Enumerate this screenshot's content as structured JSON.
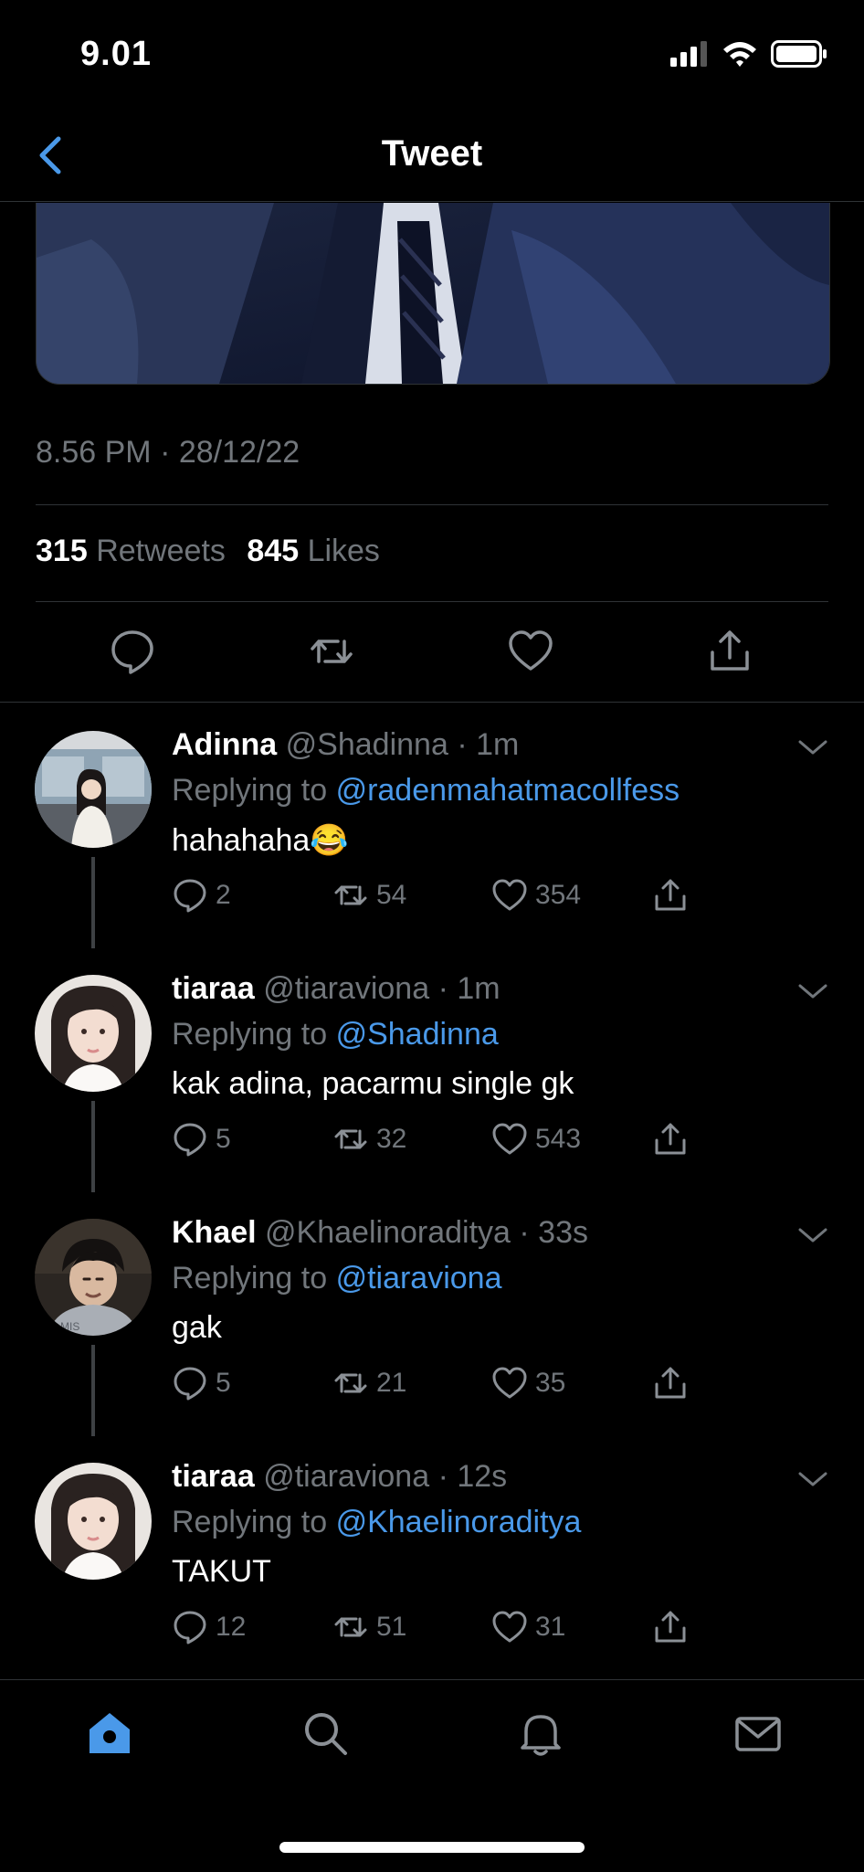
{
  "status": {
    "time": "9.01"
  },
  "nav": {
    "title": "Tweet"
  },
  "tweet": {
    "timestamp": "8.56 PM · 28/12/22",
    "retweets_count": "315",
    "retweets_label": "Retweets",
    "likes_count": "845",
    "likes_label": "Likes"
  },
  "replies": [
    {
      "name": "Adinna",
      "handle": "@Shadinna",
      "time": "· 1m",
      "replying_prefix": "Replying to",
      "replying_to": "@radenmahatmacollfess",
      "text": "hahahaha😂",
      "replies": "2",
      "retweets": "54",
      "likes": "354"
    },
    {
      "name": "tiaraa",
      "handle": "@tiaraviona",
      "time": "· 1m",
      "replying_prefix": "Replying to",
      "replying_to": "@Shadinna",
      "text": "kak adina, pacarmu single gk",
      "replies": "5",
      "retweets": "32",
      "likes": "543"
    },
    {
      "name": "Khael",
      "handle": "@Khaelinoraditya",
      "time": "· 33s",
      "replying_prefix": "Replying to",
      "replying_to": "@tiaraviona",
      "text": "gak",
      "replies": "5",
      "retweets": "21",
      "likes": "35"
    },
    {
      "name": "tiaraa",
      "handle": "@tiaraviona",
      "time": "· 12s",
      "replying_prefix": "Replying to",
      "replying_to": "@Khaelinoraditya",
      "text": "TAKUT",
      "replies": "12",
      "retweets": "51",
      "likes": "31"
    }
  ],
  "colors": {
    "accent": "#4a99e9",
    "muted": "#71767b",
    "background": "#000000"
  }
}
